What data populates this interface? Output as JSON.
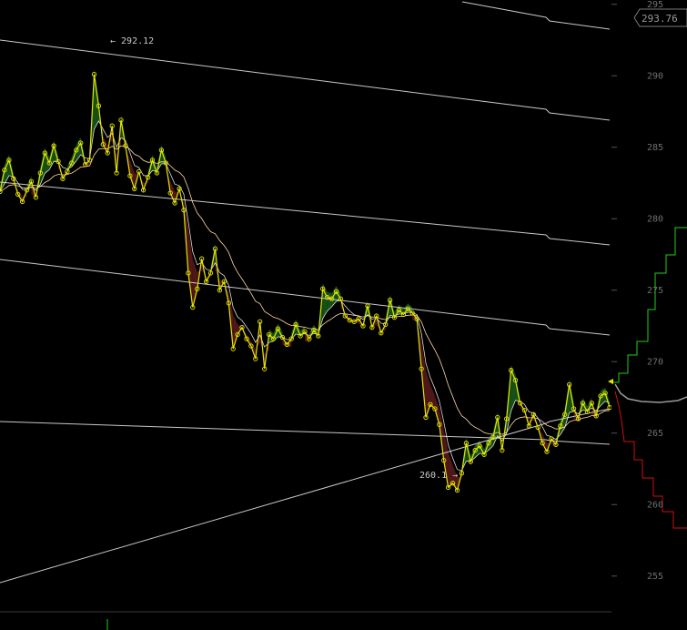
{
  "chart_data": {
    "type": "line",
    "ylim": [
      252.5,
      295.3
    ],
    "y_ticks": [
      255,
      260,
      265,
      270,
      275,
      280,
      285,
      290,
      295
    ],
    "grid": false,
    "current_price": 293.76,
    "annotations": {
      "high": {
        "label": "← 292.12",
        "value": 292.12
      },
      "low": {
        "label": "260.1 →",
        "value": 260.1
      }
    },
    "colors": {
      "price": "#e6e600",
      "average": "#ffd7a8",
      "channel": "#c8c8c8",
      "bull_fill": "#1f6b1f",
      "bear_fill": "#6b1f1f",
      "forecast_up": "#22cc22",
      "forecast_mid": "#9a9a9a",
      "forecast_down": "#cc1111"
    },
    "series": [
      {
        "values": [
          281.9,
          283.4,
          284.1,
          282.8,
          281.7,
          281.2,
          282.0,
          282.6,
          281.5,
          283.2,
          284.6,
          283.9,
          285.1,
          284.0,
          282.8,
          283.3,
          283.9,
          284.8,
          285.3,
          283.8,
          284.1,
          290.1,
          287.9,
          285.2,
          284.6,
          286.5,
          283.2,
          286.9,
          285.1,
          283.0,
          282.1,
          283.3,
          282.0,
          282.9,
          284.1,
          283.2,
          284.8,
          283.9,
          281.8,
          281.1,
          282.1,
          280.6,
          276.2,
          273.8,
          275.1,
          277.2,
          275.6,
          276.2,
          277.9,
          275.0,
          275.6,
          274.1,
          270.9,
          271.9,
          272.4,
          271.6,
          271.1,
          270.2,
          272.8,
          269.5,
          271.9,
          271.6,
          272.3,
          271.7,
          271.2,
          271.6,
          272.6,
          271.8,
          272.1,
          271.6,
          272.2,
          271.8,
          275.1,
          274.5,
          274.4,
          274.9,
          274.4,
          273.2,
          272.9,
          272.8,
          273.0,
          272.5,
          273.9,
          272.4,
          273.2,
          272.0,
          272.6,
          274.3,
          273.1,
          273.6,
          273.3,
          273.7,
          273.4,
          273.0,
          269.5,
          266.1,
          267.0,
          266.7,
          265.6,
          263.1,
          261.2,
          261.5,
          261.0,
          262.2,
          264.3,
          263.0,
          263.8,
          264.1,
          263.5,
          264.3,
          264.7,
          266.1,
          263.8,
          266.0,
          269.4,
          268.7,
          267.1,
          266.6,
          265.5,
          266.3,
          265.4,
          264.3,
          263.7,
          264.6,
          264.2,
          265.5,
          266.3,
          268.4,
          266.7,
          266.0,
          267.1,
          266.5,
          267.1,
          266.2,
          267.6,
          267.8,
          266.8
        ]
      }
    ]
  }
}
